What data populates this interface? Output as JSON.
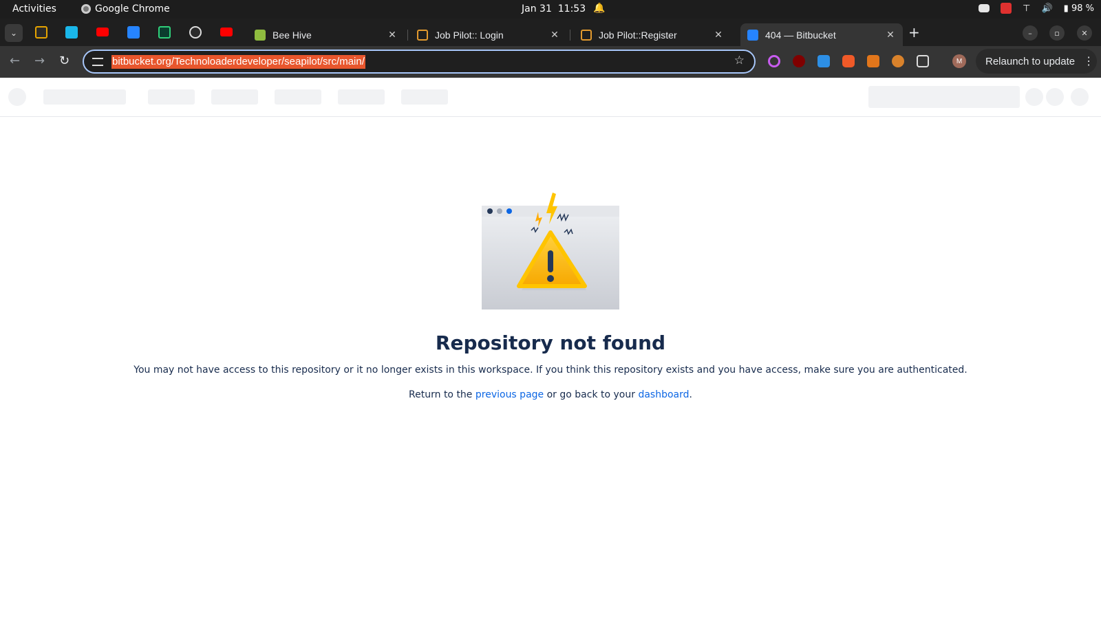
{
  "system_bar": {
    "activities": "Activities",
    "app_name": "Google Chrome",
    "date": "Jan 31",
    "time": "11:53",
    "battery": "98 %"
  },
  "tabs": [
    {
      "label": "Bee Hive",
      "icon": "bee-hive-favicon",
      "active": false
    },
    {
      "label": "Job Pilot:: Login",
      "icon": "briefcase-favicon",
      "active": false
    },
    {
      "label": "Job Pilot::Register",
      "icon": "briefcase-favicon",
      "active": false
    },
    {
      "label": "404 — Bitbucket",
      "icon": "bitbucket-favicon",
      "active": true
    }
  ],
  "pinned_tabs": [
    "goldfish-icon",
    "vimeo-icon",
    "youtube-icon",
    "bitbucket-icon",
    "monitor-icon",
    "chatgpt-icon",
    "youtube-icon"
  ],
  "toolbar": {
    "url": "bitbucket.org/Technoloaderdeveloper/seapilot/src/main/",
    "profile_initial": "M",
    "relaunch_label": "Relaunch to update"
  },
  "page": {
    "title": "Repository not found",
    "description": "You may not have access to this repository or it no longer exists in this workspace. If you think this repository exists and you have access, make sure you are authenticated.",
    "return_prefix": "Return to the ",
    "previous_page_link": "previous page",
    "return_middle": " or go back to your ",
    "dashboard_link": "dashboard",
    "return_suffix": "."
  },
  "colors": {
    "link": "#0c66e4",
    "heading": "#172b4d",
    "url_highlight": "#e8562d",
    "warning": "#ffc400"
  }
}
